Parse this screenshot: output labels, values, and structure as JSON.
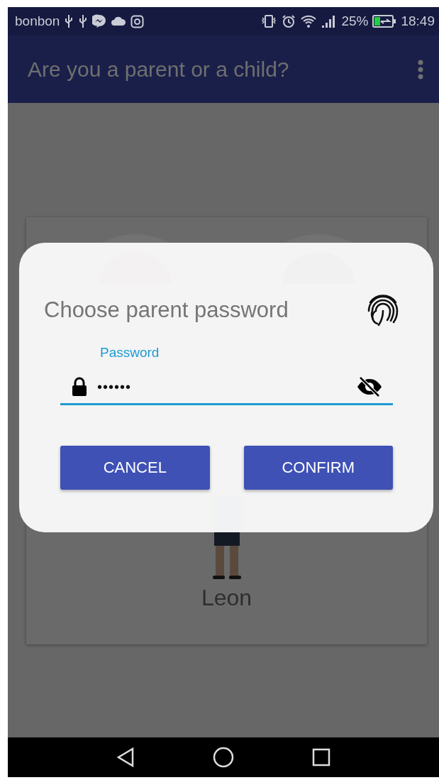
{
  "status_bar": {
    "carrier": "bonbon",
    "battery": "25%",
    "time": "18:49"
  },
  "app_bar": {
    "title": "Are you a parent or a child?"
  },
  "profiles_card": {
    "child_name": "Leon"
  },
  "dialog": {
    "title": "Choose parent password",
    "field": {
      "label": "Password",
      "value": "••••••"
    },
    "buttons": [
      "CANCEL",
      "CONFIRM"
    ]
  }
}
